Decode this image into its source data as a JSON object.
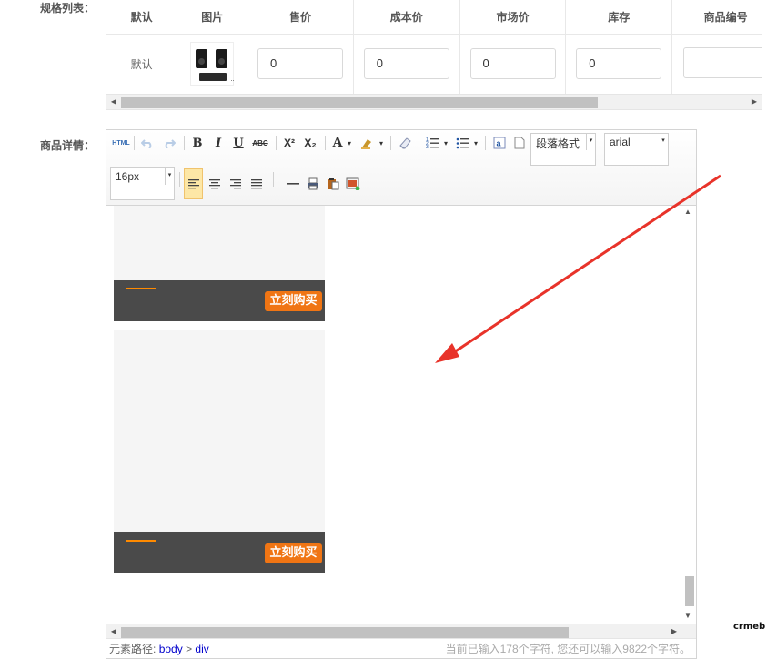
{
  "spec_section": {
    "label": "规格列表：",
    "columns": [
      "默认",
      "图片",
      "售价",
      "成本价",
      "市场价",
      "库存",
      "商品编号"
    ],
    "rows": [
      {
        "name": "默认",
        "image": "product-thumbnail",
        "price": "0",
        "cost": "0",
        "market": "0",
        "stock": "0",
        "sku": ""
      }
    ],
    "image_overflow": "..",
    "scroll_left": "◀",
    "scroll_right": "▶"
  },
  "detail_section": {
    "label": "商品详情："
  },
  "editor": {
    "toolbar": {
      "html_label": "HTML",
      "bold": "B",
      "italic": "I",
      "underline": "U",
      "strike": "ABC",
      "superscript": "X²",
      "subscript": "X₂",
      "font_color": "A",
      "paragraph_select": "段落格式",
      "font_family_select": "arial",
      "font_size_select": "16px",
      "dropdown_glyph": "▾"
    },
    "content": {
      "buy_button_1": "立刻购买",
      "buy_button_2": "立刻购买"
    },
    "status": {
      "path_label": "元素路径:",
      "path_body": "body",
      "path_sep": ">",
      "path_div": "div",
      "count_text": "当前已输入178个字符, 您还可以输入9822个字符。"
    },
    "scroll_up": "▲",
    "scroll_down": "▼",
    "scroll_left": "◀",
    "scroll_right": "▶"
  },
  "watermark": "crmeb",
  "annotation_color": "#e8332a"
}
